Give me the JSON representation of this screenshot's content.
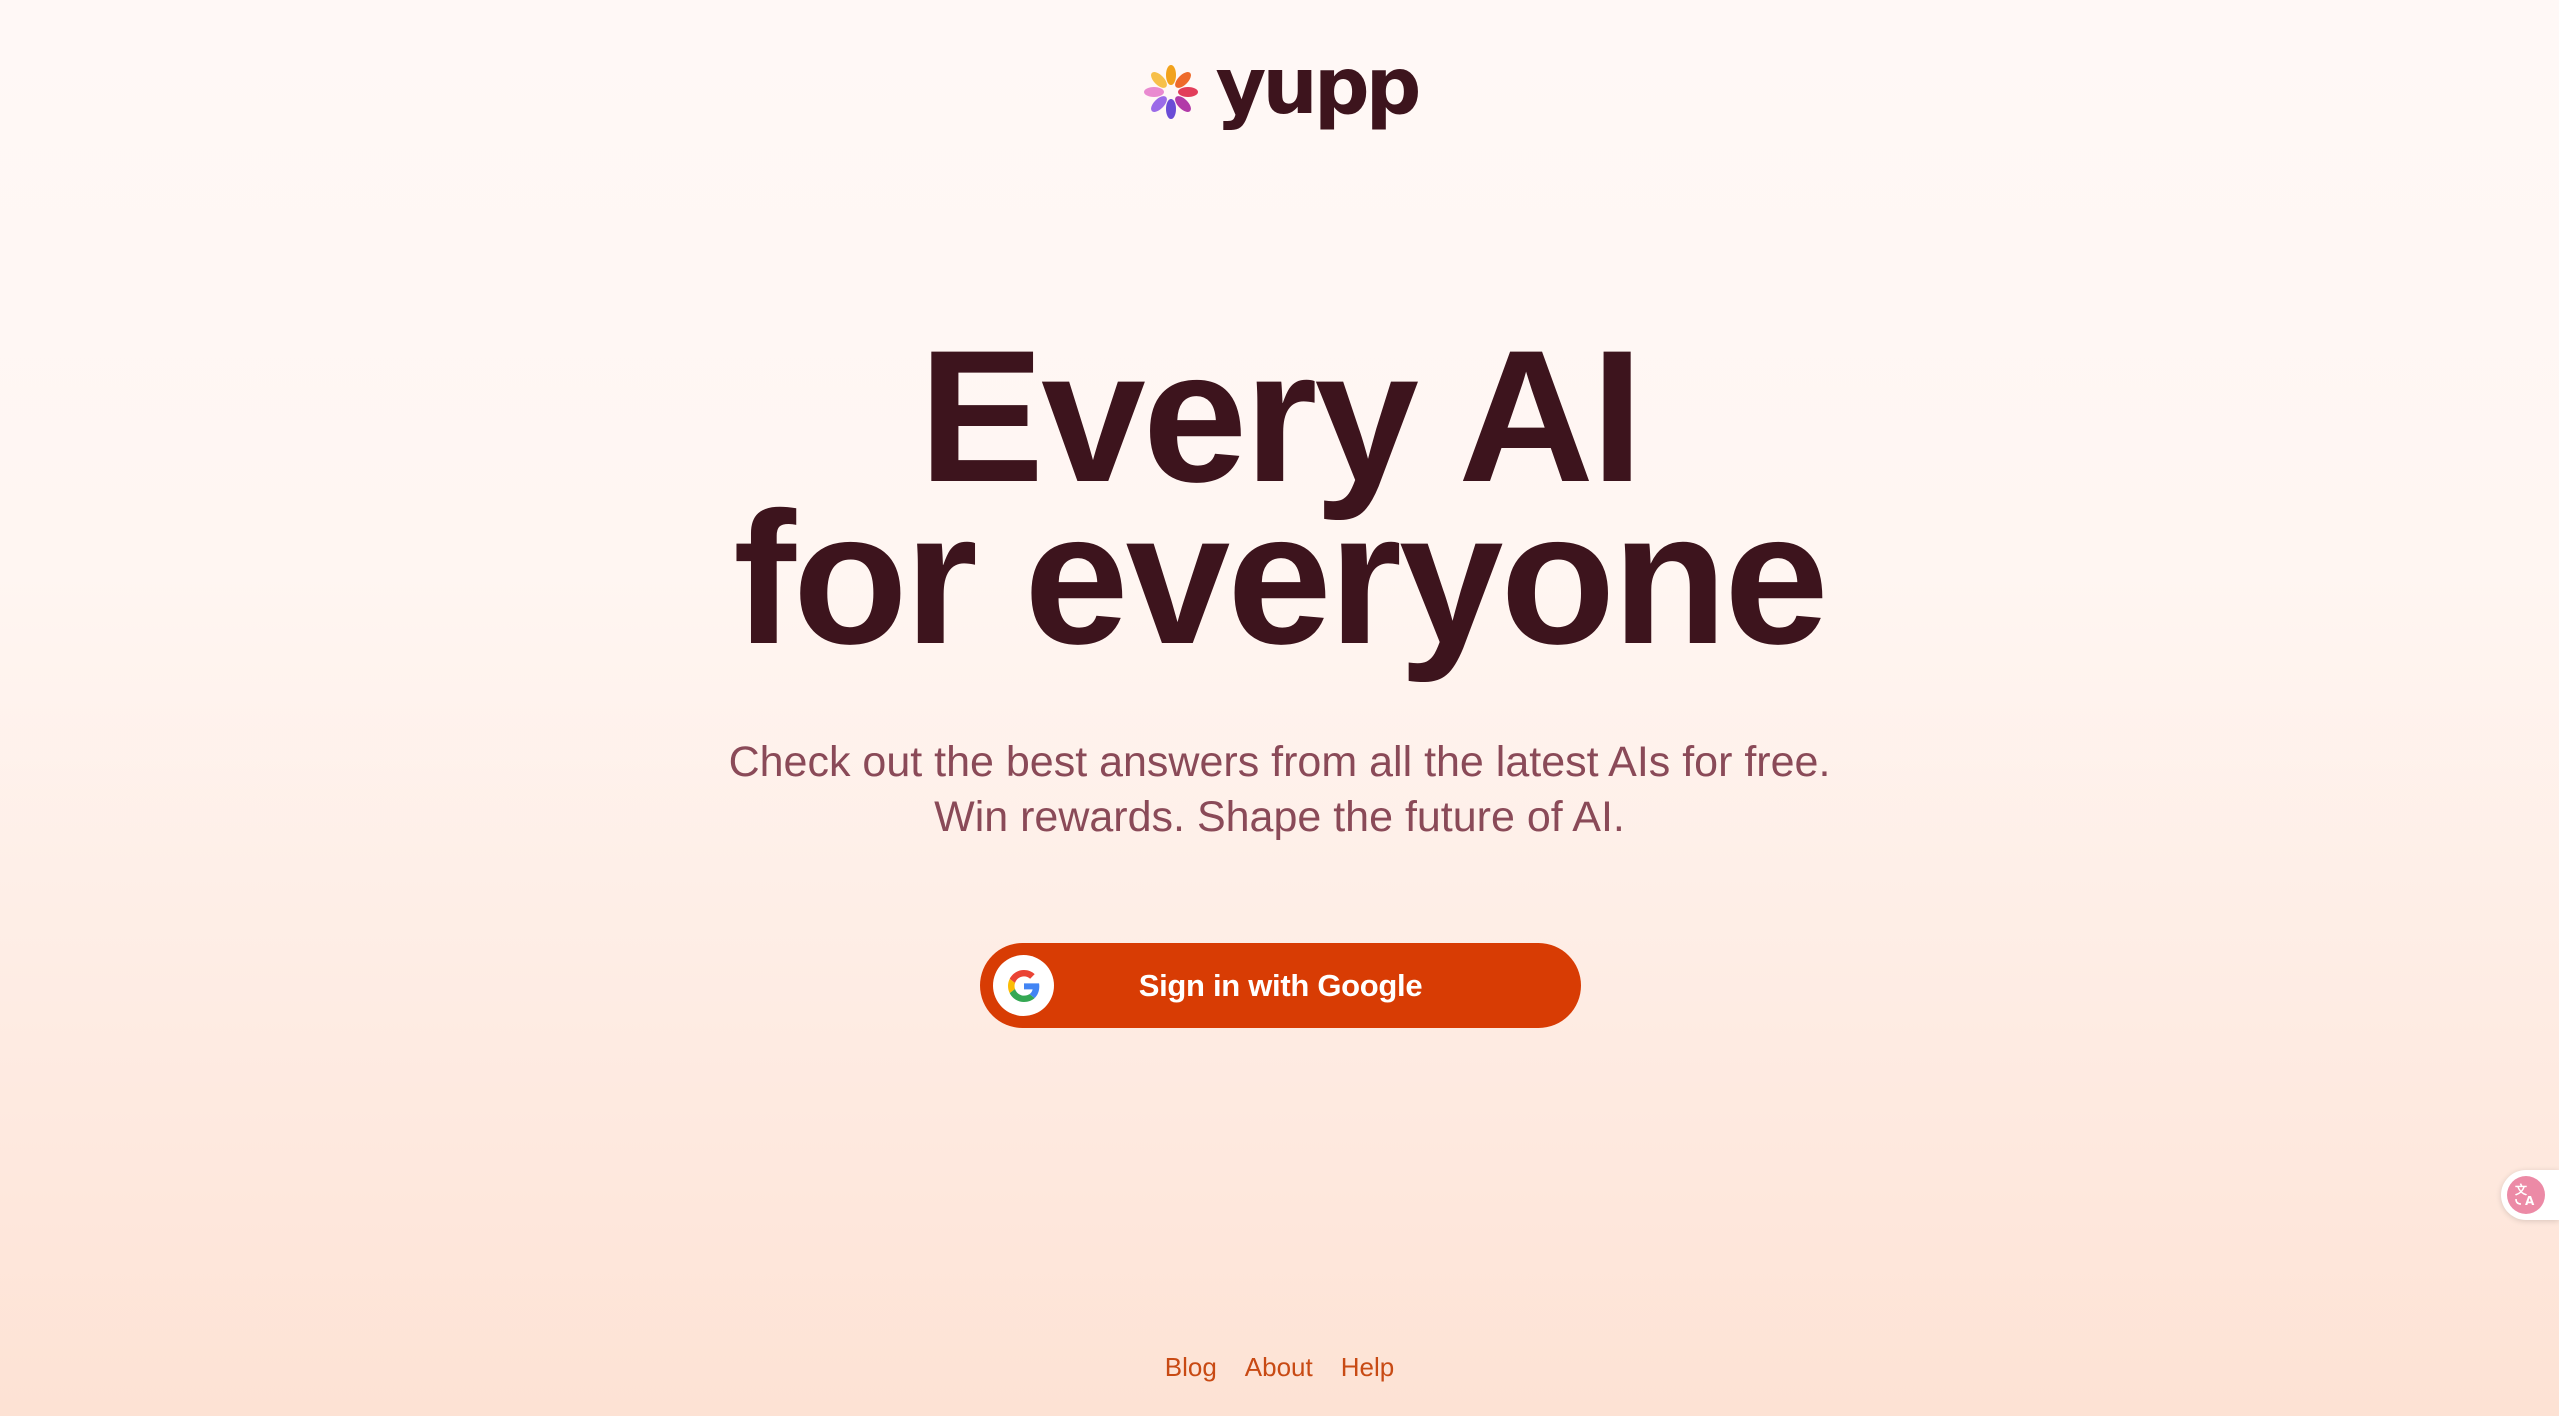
{
  "brand": {
    "name": "yupp",
    "logo_icon": "yupp-flower-icon"
  },
  "hero": {
    "title_line1": "Every AI",
    "title_line2": "for everyone",
    "subtitle_line1": "Check out the best answers from all the latest AIs for free.",
    "subtitle_line2": "Win rewards. Shape the future of AI."
  },
  "signin": {
    "label": "Sign in with Google",
    "icon": "google-icon"
  },
  "footer": {
    "links": [
      "Blog",
      "About",
      "Help"
    ]
  },
  "translate_widget": {
    "icon": "translate-icon"
  },
  "colors": {
    "primary_text": "#3d141d",
    "subtitle_text": "#8a4a58",
    "button": "#d83c04",
    "link": "#c84a14"
  }
}
